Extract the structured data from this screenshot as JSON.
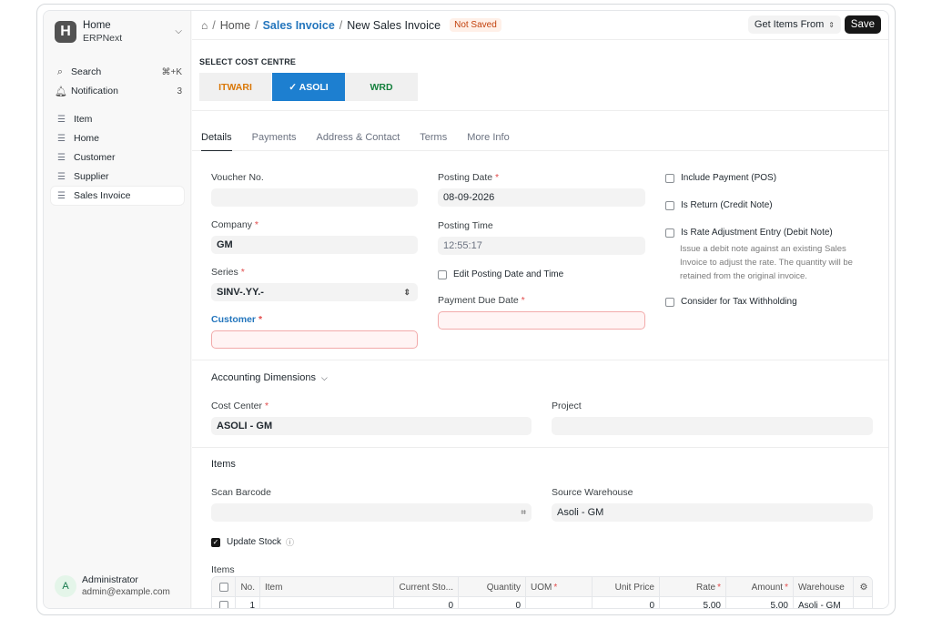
{
  "brand": {
    "title": "Home",
    "subtitle": "ERPNext",
    "logo_letter": "H"
  },
  "sidebar": {
    "search": {
      "label": "Search",
      "shortcut": "⌘+K"
    },
    "notification": {
      "label": "Notification",
      "count": "3"
    },
    "items": [
      {
        "label": "Item"
      },
      {
        "label": "Home"
      },
      {
        "label": "Customer"
      },
      {
        "label": "Supplier"
      },
      {
        "label": "Sales Invoice"
      }
    ]
  },
  "user": {
    "initial": "A",
    "name": "Administrator",
    "email": "admin@example.com"
  },
  "breadcrumb": {
    "root": "Home",
    "doctype": "Sales Invoice",
    "current": "New Sales Invoice"
  },
  "status_badge": "Not Saved",
  "toolbar": {
    "get_items_label": "Get Items From",
    "save_label": "Save"
  },
  "cost_centre": {
    "label": "SELECT COST CENTRE",
    "options": [
      {
        "label": "ITWARI",
        "color": "#d97706"
      },
      {
        "label": "✓ ASOLI",
        "color": "#ffffff",
        "selected": true
      },
      {
        "label": "WRD",
        "color": "#15803d"
      }
    ]
  },
  "tabs": [
    "Details",
    "Payments",
    "Address & Contact",
    "Terms",
    "More Info"
  ],
  "form": {
    "voucher_no": {
      "label": "Voucher No.",
      "value": ""
    },
    "company": {
      "label": "Company",
      "value": "GM"
    },
    "series": {
      "label": "Series",
      "value": "SINV-.YY.-"
    },
    "customer": {
      "label": "Customer",
      "value": ""
    },
    "posting_date": {
      "label": "Posting Date",
      "value": "08-09-2026"
    },
    "posting_time": {
      "label": "Posting Time",
      "value": "12:55:17"
    },
    "edit_posting": {
      "label": "Edit Posting Date and Time"
    },
    "payment_due_date": {
      "label": "Payment Due Date",
      "value": ""
    },
    "include_payment": {
      "label": "Include Payment (POS)"
    },
    "is_return": {
      "label": "Is Return (Credit Note)"
    },
    "is_rate_adjustment": {
      "label": "Is Rate Adjustment Entry (Debit Note)",
      "help": [
        "Issue a debit note against an existing Sales",
        "Invoice to adjust the rate. The quantity will be",
        "retained from the original invoice."
      ]
    },
    "tax_withholding": {
      "label": "Consider for Tax Withholding"
    }
  },
  "accounting": {
    "title": "Accounting Dimensions",
    "cost_center": {
      "label": "Cost Center",
      "value": "ASOLI - GM"
    },
    "project": {
      "label": "Project",
      "value": ""
    }
  },
  "items_section": {
    "title": "Items",
    "scan_barcode": {
      "label": "Scan Barcode",
      "value": ""
    },
    "source_warehouse": {
      "label": "Source Warehouse",
      "value": "Asoli - GM"
    },
    "update_stock": {
      "label": "Update Stock",
      "checked": true
    },
    "table_label": "Items",
    "columns": [
      "No.",
      "Item",
      "Current Sto...",
      "Quantity",
      "UOM",
      "Unit Price",
      "Rate",
      "Amount",
      "Warehouse"
    ],
    "row": {
      "no": "1",
      "item": "",
      "current_stock": "0",
      "quantity": "0",
      "uom": "",
      "unit_price": "0",
      "rate": "5.00",
      "amount": "5.00",
      "warehouse": "Asoli - GM"
    }
  }
}
